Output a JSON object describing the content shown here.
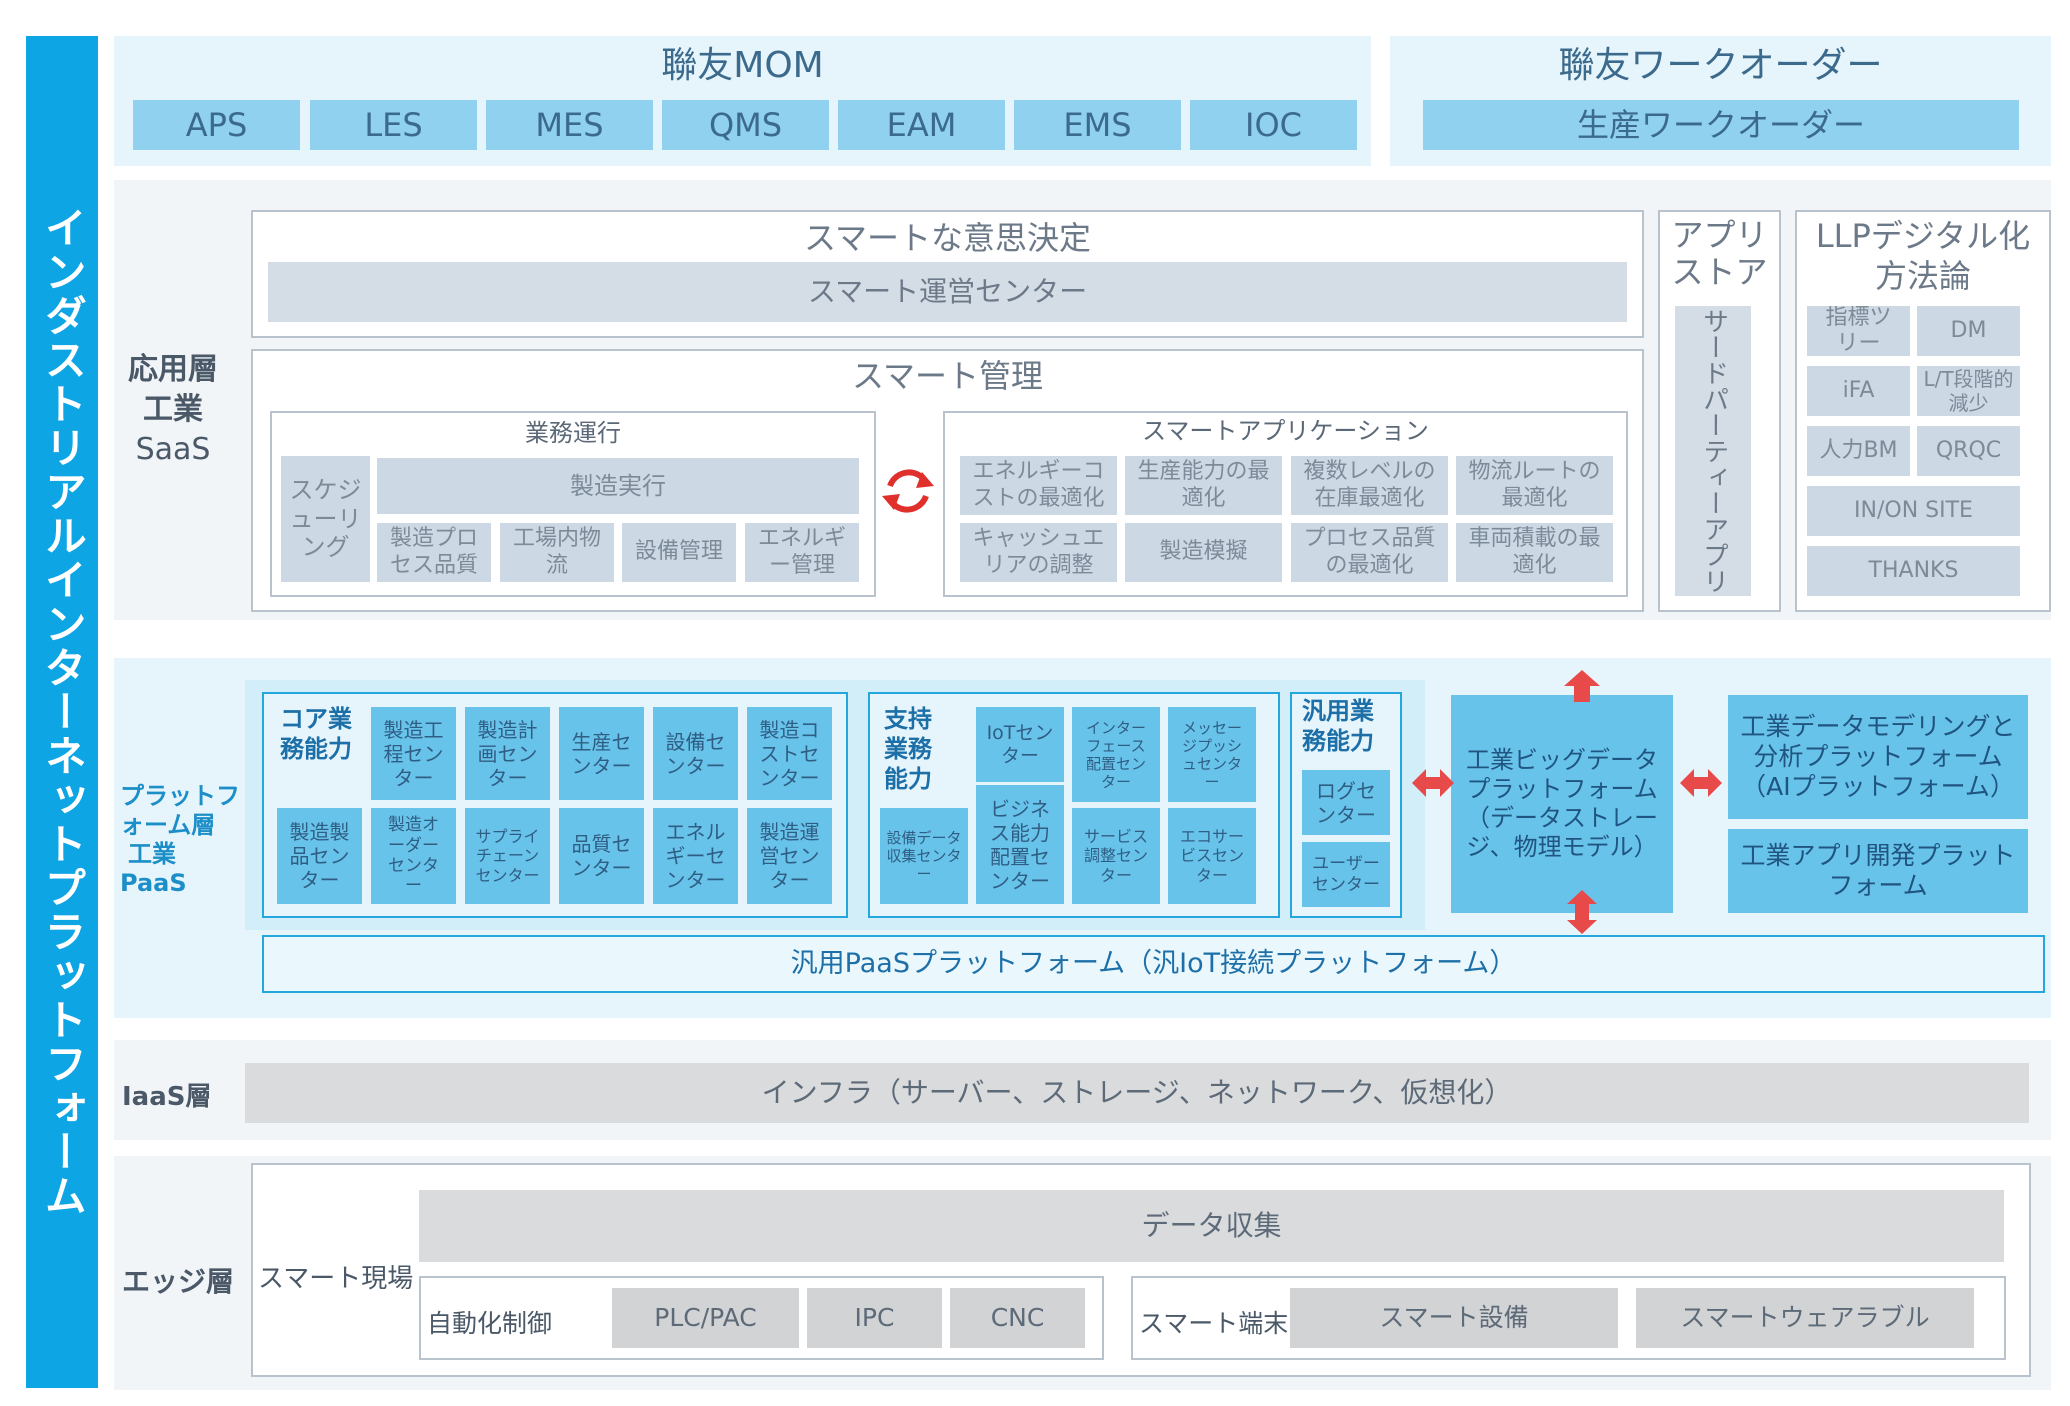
{
  "sidebar": {
    "title": "インダストリアルインターネットプラットフォーム"
  },
  "mom": {
    "title": "聯友MOM",
    "items": [
      "APS",
      "LES",
      "MES",
      "QMS",
      "EAM",
      "EMS",
      "IOC"
    ]
  },
  "workorder": {
    "title": "聯友ワークオーダー",
    "item": "生産ワークオーダー"
  },
  "saas": {
    "layer_label_1": "応用層",
    "layer_label_2": "工業",
    "layer_label_3": "SaaS",
    "decision": {
      "title": "スマートな意思決定",
      "bar": "スマート運営センター"
    },
    "management": {
      "title": "スマート管理",
      "business_ops": {
        "title": "業務運行",
        "schedule": "スケジューリング",
        "exec_title": "製造実行",
        "exec_items": [
          "製造プロセス品質",
          "工場内物流",
          "設備管理",
          "エネルギー管理"
        ]
      },
      "smart_apps": {
        "title": "スマートアプリケーション",
        "items": [
          "エネルギーコストの最適化",
          "生産能力の最適化",
          "複数レベルの在庫最適化",
          "物流ルートの最適化",
          "キャッシュエリアの調整",
          "製造模擬",
          "プロセス品質の最適化",
          "車両積載の最適化"
        ]
      }
    },
    "app_store": {
      "title": "アプリストア",
      "item": "サードパーティーアプリ"
    },
    "llp": {
      "title": "LLPデジタル化方法論",
      "items": [
        "指標ツリー",
        "DM",
        "iFA",
        "L/T段階的減少",
        "人力BM",
        "QRQC"
      ],
      "wide_items": [
        "IN/ON SITE",
        "THANKS"
      ]
    }
  },
  "paas": {
    "layer_label_1": "プラットフ",
    "layer_label_2": "ォーム層",
    "layer_label_3": "工業",
    "layer_label_4": "PaaS",
    "core": {
      "title": "コア業務能力",
      "items": [
        "製造工程センター",
        "製造計画センター",
        "生産センター",
        "設備センター",
        "製造コストセンター",
        "製造製品センター",
        "製造オーダーセンター",
        "サプライチェーンセンター",
        "品質センター",
        "エネルギーセンター",
        "製造運営センター"
      ]
    },
    "support": {
      "title": "支持業務能力",
      "items": [
        "IoTセンター",
        "インターフェース配置センター",
        "メッセージプッシュセンター",
        "設備データ収集センター",
        "ビジネス能力配置センター",
        "サービス調整センター",
        "エコサービスセンター"
      ]
    },
    "general": {
      "title": "汎用業務能力",
      "items": [
        "ログセンター",
        "ユーザーセンター"
      ]
    },
    "bigdata": "工業ビッグデータプラットフォーム（データストレージ、物理モデル）",
    "modeling": "工業データモデリングと分析プラットフォーム（AIプラットフォーム）",
    "appdev": "工業アプリ開発プラットフォーム",
    "general_paas": "汎用PaaSプラットフォーム（汎IoT接続プラットフォーム）"
  },
  "iaas": {
    "layer_label": "IaaS層",
    "bar": "インフラ（サーバー、ストレージ、ネットワーク、仮想化）"
  },
  "edge": {
    "layer_label": "エッジ層",
    "site_label": "スマート現場",
    "data_collection": "データ収集",
    "automation": {
      "label": "自動化制御",
      "items": [
        "PLC/PAC",
        "IPC",
        "CNC"
      ]
    },
    "terminal": {
      "label": "スマート端末",
      "items": [
        "スマート設備",
        "スマートウェアラブル"
      ]
    }
  },
  "colors": {
    "accent": "#0ea5e4",
    "light_blue": "#8fd1ef",
    "gray_block": "#ccd8e4",
    "red_arrow": "#e84a4a"
  }
}
